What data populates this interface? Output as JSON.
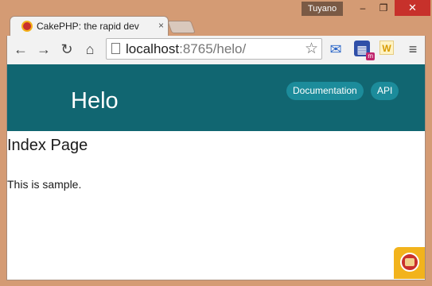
{
  "window": {
    "user_name": "Tuyano",
    "minimize_glyph": "–",
    "maximize_glyph": "❐",
    "close_glyph": "✕"
  },
  "tab": {
    "title": "CakePHP: the rapid dev",
    "close_glyph": "×"
  },
  "toolbar": {
    "back_glyph": "←",
    "forward_glyph": "→",
    "reload_glyph": "↻",
    "home_glyph": "⌂",
    "url_host": "localhost",
    "url_rest": ":8765/helo/",
    "star_glyph": "☆",
    "menu_glyph": "≡",
    "extensions": [
      {
        "name": "mail-extension-icon",
        "glyph": "✉"
      },
      {
        "name": "calendar-extension-icon",
        "glyph": "▦",
        "badge": "m"
      },
      {
        "name": "w-extension-icon",
        "glyph": "W"
      }
    ]
  },
  "page": {
    "header": {
      "title": "Helo",
      "nav": [
        "Documentation",
        "API"
      ],
      "background": "#116671",
      "pill_color": "#1c8c9b"
    },
    "heading": "Index Page",
    "body_text": "This is sample."
  }
}
